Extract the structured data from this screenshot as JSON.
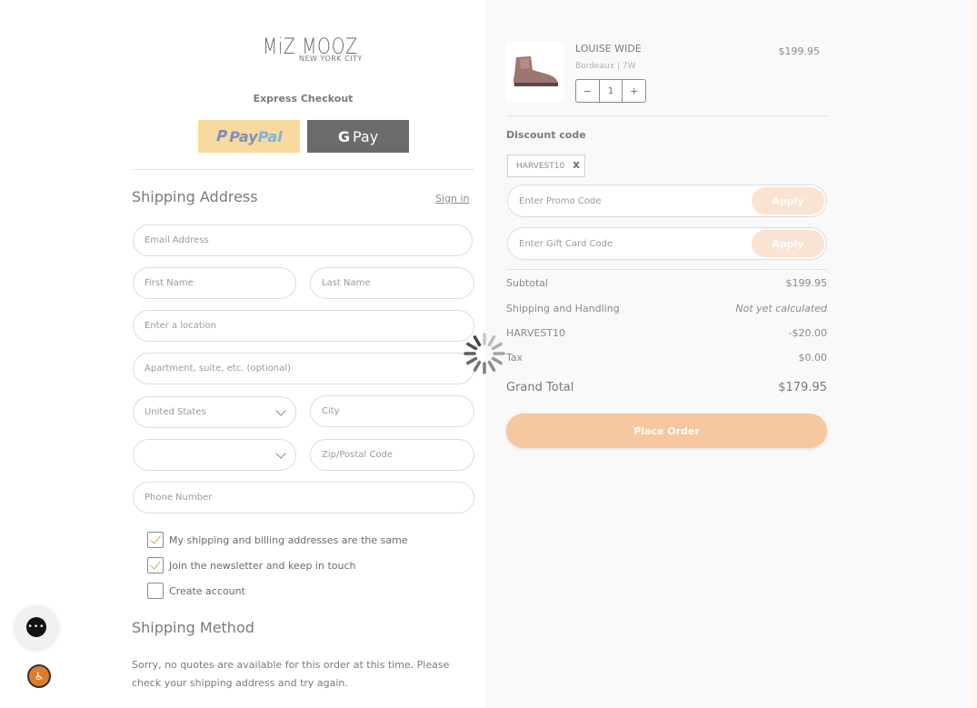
{
  "brand": {
    "logo_main": "MiZ MOOZ",
    "logo_sub": "NEW YORK CITY"
  },
  "express": {
    "label": "Express Checkout",
    "paypal_a": "Pay",
    "paypal_b": "Pal",
    "gpay_g": "G",
    "gpay_label": "Pay"
  },
  "shipping_address": {
    "title": "Shipping Address",
    "sign_in": "Sign in",
    "email_placeholder": "Email Address",
    "first_name_placeholder": "First Name",
    "last_name_placeholder": "Last Name",
    "location_placeholder": "Enter a location",
    "apartment_placeholder": "Apartment, suite, etc. (optional)",
    "country_value": "United States",
    "city_placeholder": "City",
    "state_value": "",
    "zip_placeholder": "Zip/Postal Code",
    "phone_placeholder": "Phone Number"
  },
  "checkboxes": [
    {
      "label": "My shipping and billing addresses are the same",
      "checked": true
    },
    {
      "label": "Join the newsletter and keep in touch",
      "checked": true
    },
    {
      "label": "Create account",
      "checked": false
    }
  ],
  "shipping_method": {
    "title": "Shipping Method",
    "note": "Sorry, no quotes are available for this order at this time. Please check your shipping address and try again."
  },
  "cart": {
    "product_name": "LOUISE WIDE",
    "variant": "Bordeaux | 7W",
    "price": "$199.95",
    "qty_minus": "−",
    "quantity": "1",
    "qty_plus": "+"
  },
  "discount": {
    "title": "Discount code",
    "applied_code": "HARVEST10",
    "remove_label": "X",
    "promo_placeholder": "Enter Promo Code",
    "gift_placeholder": "Enter Gift Card Code",
    "apply_label": "Apply"
  },
  "summary": {
    "subtotal_label": "Subtotal",
    "subtotal_value": "$199.95",
    "shipping_label": "Shipping and Handling",
    "shipping_value": "Not yet calculated",
    "discount_label": "HARVEST10",
    "discount_value": "-$20.00",
    "tax_label": "Tax",
    "tax_value": "$0.00",
    "grand_label": "Grand Total",
    "grand_value": "$179.95"
  },
  "place_order_label": "Place Order",
  "colors": {
    "accent": "#f7c79f",
    "apply_bg": "#fbe3d1",
    "paypal_bg": "#f8d99e",
    "gpay_bg": "#6b6b6b",
    "access_bg": "#e07b2a"
  },
  "icons": {
    "chat": "chat-bubble-icon",
    "accessibility": "accessibility-icon",
    "spinner": "loading-spinner-icon",
    "chevron": "chevron-down-icon"
  }
}
